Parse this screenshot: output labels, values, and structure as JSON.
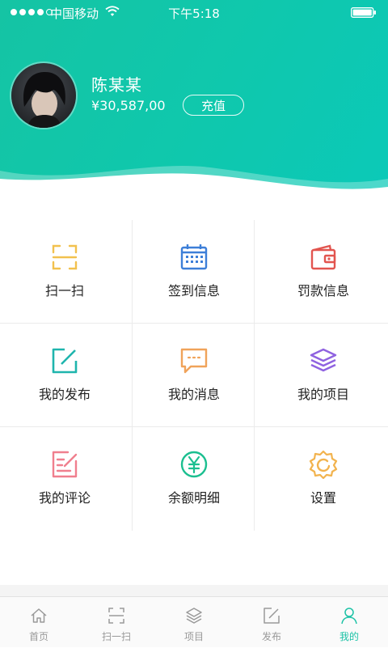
{
  "status_bar": {
    "carrier": "中国移动",
    "time": "下午5:18"
  },
  "profile": {
    "name": "陈某某",
    "balance": "¥30,587,00",
    "recharge_label": "充值"
  },
  "menu": [
    {
      "label": "扫一扫",
      "icon": "scan-icon",
      "color": "#f2c14e"
    },
    {
      "label": "签到信息",
      "icon": "calendar-icon",
      "color": "#3d7fd8"
    },
    {
      "label": "罚款信息",
      "icon": "wallet-icon",
      "color": "#e2554f"
    },
    {
      "label": "我的发布",
      "icon": "edit-icon",
      "color": "#1fb5ad"
    },
    {
      "label": "我的消息",
      "icon": "message-icon",
      "color": "#f0a35a"
    },
    {
      "label": "我的项目",
      "icon": "layers-icon",
      "color": "#8f62e0"
    },
    {
      "label": "我的评论",
      "icon": "comment-edit-icon",
      "color": "#f07f8e"
    },
    {
      "label": "余额明细",
      "icon": "yuan-icon",
      "color": "#1cbf90"
    },
    {
      "label": "设置",
      "icon": "gear-icon",
      "color": "#f2b34e"
    }
  ],
  "tabbar": {
    "active_color": "#1cc2a6",
    "items": [
      {
        "label": "首页",
        "icon": "home-icon"
      },
      {
        "label": "扫一扫",
        "icon": "scan-icon"
      },
      {
        "label": "项目",
        "icon": "layers-icon"
      },
      {
        "label": "发布",
        "icon": "edit-icon"
      },
      {
        "label": "我的",
        "icon": "user-icon",
        "active": true
      }
    ]
  }
}
